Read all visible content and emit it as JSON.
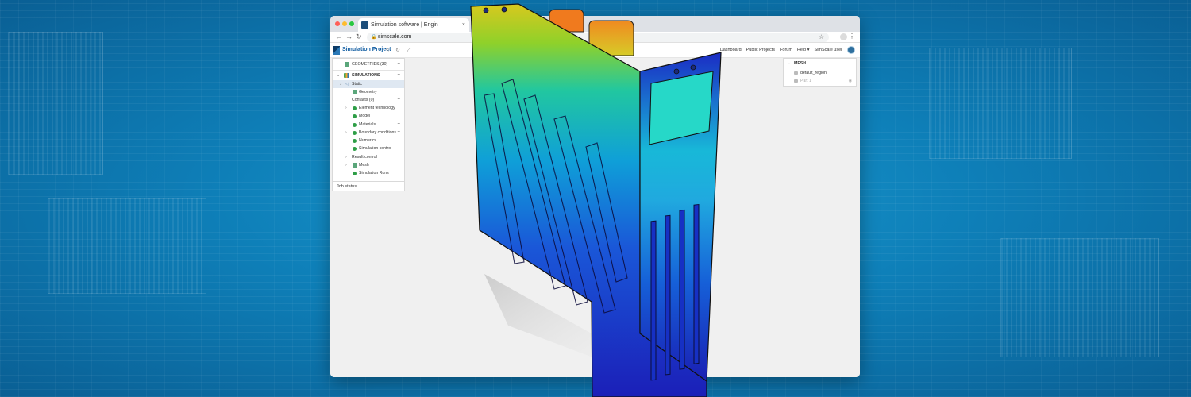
{
  "browser": {
    "tab_title": "Simulation software | Engin",
    "tab_close": "×",
    "url": "simscale.com"
  },
  "app": {
    "title": "Simulation Project",
    "actions": "< ↻ ⤢",
    "nav": {
      "dashboard": "Dashboard",
      "public_projects": "Public Projects",
      "forum": "Forum",
      "help": "Help ▾",
      "user": "SimScale user"
    }
  },
  "tree": {
    "geometries": "GEOMETRIES (30)",
    "simulations": "SIMULATIONS",
    "static": "Static",
    "geometry": "Geometry",
    "contacts": "Contacts (0)",
    "element_technology": "Element technology",
    "model": "Model",
    "materials": "Materials",
    "boundary_conditions": "Boundary conditions",
    "numerics": "Numerics",
    "simulation_control": "Simulation control",
    "result_control": "Result control",
    "mesh": "Mesh",
    "simulation_runs": "Simulation Runs",
    "job_status": "Job status"
  },
  "mesh_panel": {
    "header": "MESH",
    "items": [
      {
        "label": "default_region"
      },
      {
        "label": "Part 1"
      }
    ]
  },
  "colors": {
    "accent": "#0d5aa0",
    "check": "#2e9e47",
    "bg": "#1289c4"
  }
}
